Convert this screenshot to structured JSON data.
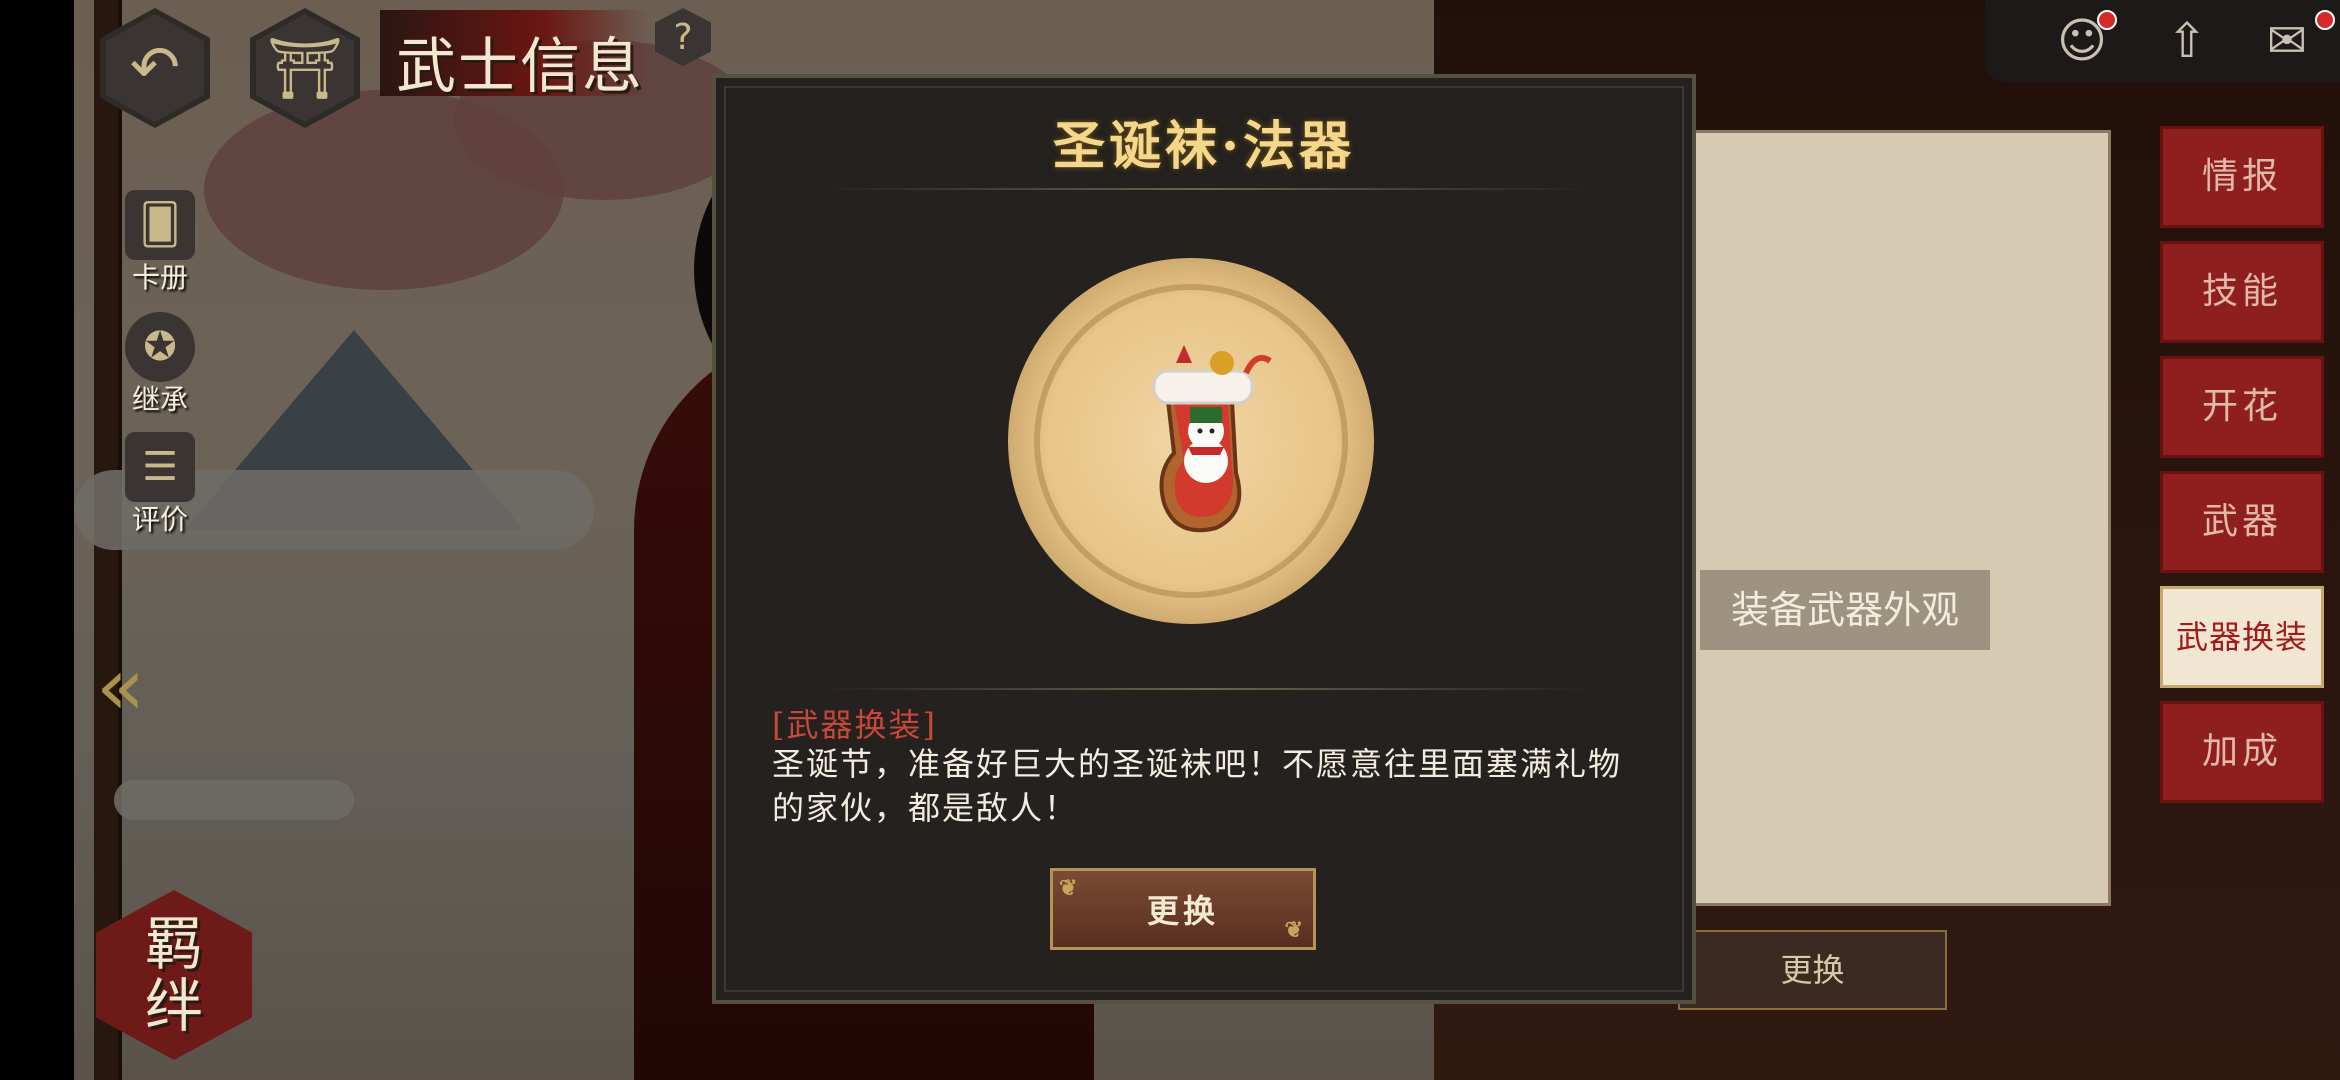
{
  "header": {
    "back_icon": "back-arrow-icon",
    "home_icon": "gate-home-icon",
    "title": "武士信息",
    "help_label": "?"
  },
  "sidebar": {
    "items": [
      {
        "label": "卡册",
        "icon": "card-album-icon"
      },
      {
        "label": "继承",
        "icon": "inherit-star-icon"
      },
      {
        "label": "评价",
        "icon": "review-list-icon"
      }
    ],
    "bond_label": [
      "羁",
      "绊"
    ]
  },
  "top_right": {
    "icons": [
      "character-icon",
      "upgrade-arrow-icon",
      "mail-icon"
    ]
  },
  "right_panel": {
    "hint": "装备武器外观",
    "change_label": "更换",
    "tabs": [
      {
        "label": "情报",
        "active": false
      },
      {
        "label": "技能",
        "active": false
      },
      {
        "label": "开花",
        "active": false
      },
      {
        "label": "武器",
        "active": false
      },
      {
        "label": "武器换装",
        "active": true
      },
      {
        "label": "加成",
        "active": false
      }
    ]
  },
  "dialog": {
    "title": "圣诞袜·法器",
    "item_icon": "christmas-stocking-icon",
    "tag": "[武器换装]",
    "description": "圣诞节，准备好巨大的圣诞袜吧！不愿意往里面塞满礼物的家伙，都是敌人！",
    "button_label": "更换"
  },
  "colors": {
    "title_gold": "#f4d78a",
    "tag_red": "#c8473c",
    "tab_red": "#8f1e1f",
    "dialog_bg": "#24211e"
  }
}
